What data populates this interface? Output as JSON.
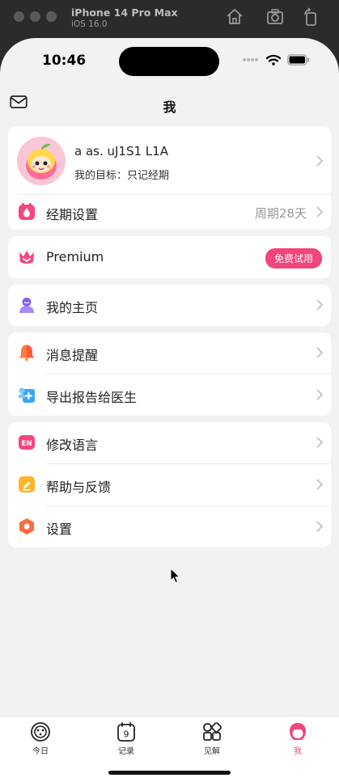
{
  "simulator": {
    "device": "iPhone 14 Pro Max",
    "os": "iOS 16.0"
  },
  "status_bar": {
    "time": "10:46"
  },
  "nav": {
    "title": "我"
  },
  "profile": {
    "name": "a as.  uJ1S1  L1A",
    "goal": "我的目标：只记经期"
  },
  "period_settings": {
    "label": "经期设置",
    "value": "周期28天"
  },
  "premium": {
    "label": "Premium",
    "badge": "免费试用"
  },
  "menu": {
    "homepage": "我的主页",
    "notifications": "消息提醒",
    "export_report": "导出报告给医生",
    "language": "修改语言",
    "help": "帮助与反馈",
    "settings": "设置"
  },
  "tabs": [
    {
      "label": "今日",
      "icon": "today-icon"
    },
    {
      "label": "记录",
      "icon": "calendar-icon",
      "day": "9"
    },
    {
      "label": "见解",
      "icon": "grid-icon"
    },
    {
      "label": "我",
      "icon": "profile-icon"
    }
  ],
  "colors": {
    "accent": "#f0467b",
    "background": "#f2f2f4"
  }
}
